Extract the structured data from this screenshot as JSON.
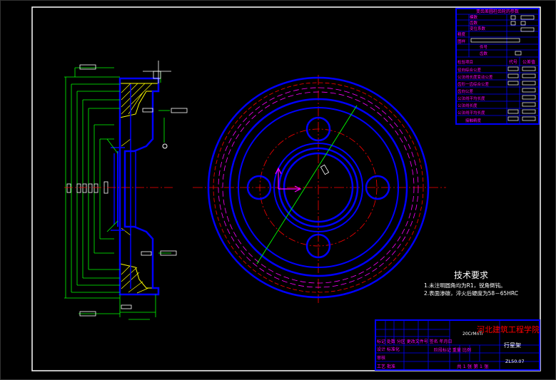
{
  "drawing": {
    "school": "河北建筑工程学院",
    "part_name": "行星架",
    "drawing_no": "ZL50.07",
    "material": "20CrMnTi",
    "tech_title": "技术要求",
    "tech_notes": [
      "1.未注明圆角均为R1，锐角倒钝。",
      "2.表面渗碳，淬火后硬度为58－65HRC"
    ]
  },
  "param_table": {
    "title": "变齿差圆柱齿轮的参数",
    "rows": [
      "模数",
      "齿数",
      "变位系数",
      "精度",
      "图样",
      "件号",
      "齿数",
      "检验项目",
      "径向综合公差",
      "公法线长度变动公差",
      "齿形一齿综合公差",
      "齿向公差",
      "公法线平均长度",
      "公法线长度",
      "公法线平均长度",
      "接触精度"
    ],
    "col_headers": [
      "代号",
      "公差值"
    ]
  },
  "title_block": {
    "rows": [
      "标记 处数 分区 更改文件号 签名 年月日",
      "设计 标准化",
      "审核",
      "工艺 批准"
    ],
    "stage_mark": "阶段标记 重量 比例",
    "sheets": "共 1 张  第 1 张"
  },
  "colors": {
    "outline": "#ffffff",
    "part": "#0000ff",
    "dim": "#00ff00",
    "hatch": "#ffff00",
    "center": "#ff0000",
    "text_magenta": "#ff00ff",
    "title_text": "#ff0000",
    "annotation": "#ffffff"
  }
}
